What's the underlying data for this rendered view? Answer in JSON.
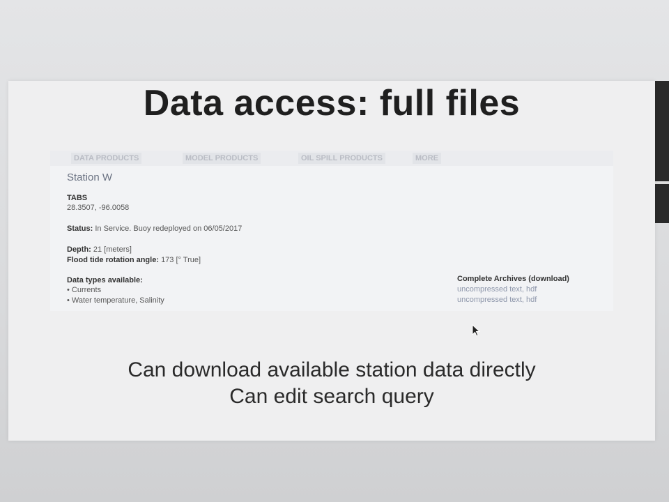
{
  "slide": {
    "title": "Data access: full files",
    "caption_line1": "Can download available station data directly",
    "caption_line2": "Can edit search query"
  },
  "nav": {
    "items": [
      "DATA PRODUCTS",
      "MODEL PRODUCTS",
      "OIL SPILL PRODUCTS",
      "MORE"
    ]
  },
  "station": {
    "name": "Station W",
    "network": "TABS",
    "coords": "28.3507, -96.0058",
    "status_label": "Status:",
    "status_value": "In Service. Buoy redeployed on 06/05/2017",
    "depth_label": "Depth:",
    "depth_value": "21 [meters]",
    "flood_label": "Flood tide rotation angle:",
    "flood_value": "173 [° True]",
    "data_types_label": "Data types available:",
    "data_types": [
      "• Currents",
      "• Water temperature, Salinity"
    ],
    "archives_label": "Complete Archives (download)",
    "archives": [
      "uncompressed text, hdf",
      "uncompressed text, hdf"
    ]
  },
  "colors": {
    "slide_bg": "#efeff0",
    "link": "#8d96aa",
    "title_text": "#1f1f1f"
  }
}
